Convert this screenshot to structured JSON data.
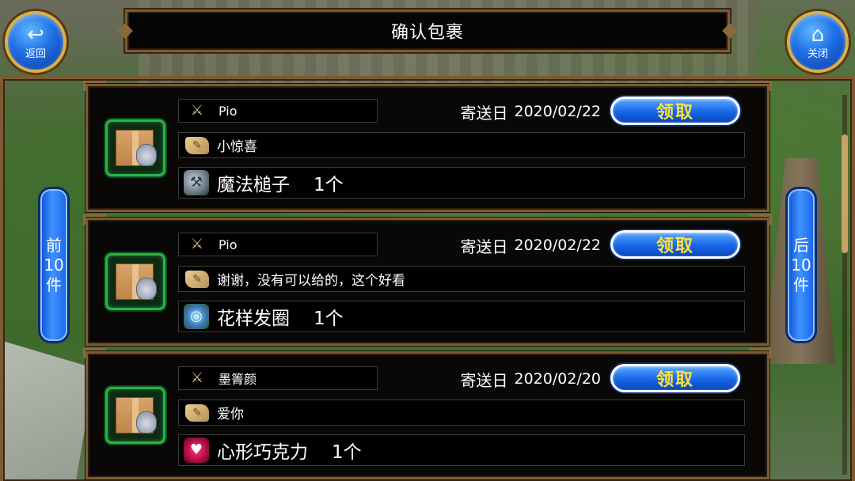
{
  "header": {
    "title": "确认包裹",
    "back_label": "返回",
    "close_label": "关闭"
  },
  "pager": {
    "prev_label": [
      "前",
      "10",
      "件"
    ],
    "next_label": [
      "后",
      "10",
      "件"
    ]
  },
  "date_prefix": "寄送日",
  "claim_label": "领取",
  "parcels": [
    {
      "sender": "Pio",
      "date": "2020/02/22",
      "message": "小惊喜",
      "item_name": "魔法槌子",
      "item_count": "1个",
      "item_icon": "hammer-icon"
    },
    {
      "sender": "Pio",
      "date": "2020/02/22",
      "message": "谢谢，没有可以给的，这个好看",
      "item_name": "花样发圈",
      "item_count": "1个",
      "item_icon": "hair-tie-icon"
    },
    {
      "sender": "墨箐颜",
      "date": "2020/02/20",
      "message": "爱你",
      "item_name": "心形巧克力",
      "item_count": "1个",
      "item_icon": "heart-chocolate-icon"
    }
  ],
  "colors": {
    "frame_brown": "#7a5b33",
    "claim_blue": "#1766e8",
    "claim_text_yellow": "#ffe23a",
    "package_border_green": "#2bb34a"
  }
}
